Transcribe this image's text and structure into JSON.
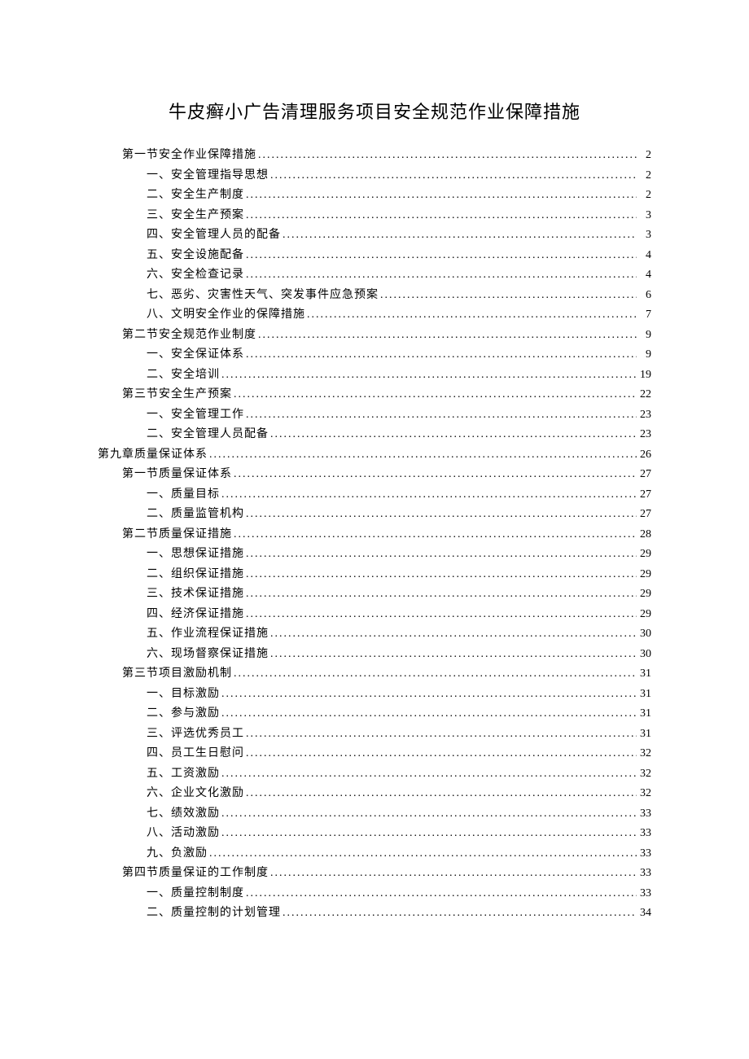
{
  "title": "牛皮癣小广告清理服务项目安全规范作业保障措施",
  "toc": [
    {
      "level": 1,
      "label": "第一节安全作业保障措施",
      "page": "2"
    },
    {
      "level": 2,
      "label": "一、安全管理指导思想",
      "page": "2"
    },
    {
      "level": 2,
      "label": "二、安全生产制度",
      "page": "2"
    },
    {
      "level": 2,
      "label": "三、安全生产预案",
      "page": "3"
    },
    {
      "level": 2,
      "label": "四、安全管理人员的配备",
      "page": "3"
    },
    {
      "level": 2,
      "label": "五、安全设施配备",
      "page": "4"
    },
    {
      "level": 2,
      "label": "六、安全检查记录",
      "page": "4"
    },
    {
      "level": 2,
      "label": "七、恶劣、灾害性天气、突发事件应急预案",
      "page": "6"
    },
    {
      "level": 2,
      "label": "八、文明安全作业的保障措施",
      "page": "7"
    },
    {
      "level": 1,
      "label": "第二节安全规范作业制度",
      "page": "9"
    },
    {
      "level": 2,
      "label": "一、安全保证体系",
      "page": "9"
    },
    {
      "level": 2,
      "label": "二、安全培训",
      "page": "19"
    },
    {
      "level": 1,
      "label": "第三节安全生产预案",
      "page": "22"
    },
    {
      "level": 2,
      "label": "一、安全管理工作",
      "page": "23"
    },
    {
      "level": 2,
      "label": "二、安全管理人员配备",
      "page": "23"
    },
    {
      "level": 0,
      "label": "第九章质量保证体系",
      "page": "26"
    },
    {
      "level": 1,
      "label": "第一节质量保证体系",
      "page": "27"
    },
    {
      "level": 2,
      "label": "一、质量目标",
      "page": "27"
    },
    {
      "level": 2,
      "label": "二、质量监管机构",
      "page": "27"
    },
    {
      "level": 1,
      "label": "第二节质量保证措施",
      "page": "28"
    },
    {
      "level": 2,
      "label": "一、思想保证措施",
      "page": "29"
    },
    {
      "level": 2,
      "label": "二、组织保证措施",
      "page": "29"
    },
    {
      "level": 2,
      "label": "三、技术保证措施",
      "page": "29"
    },
    {
      "level": 2,
      "label": "四、经济保证措施",
      "page": "29"
    },
    {
      "level": 2,
      "label": "五、作业流程保证措施",
      "page": "30"
    },
    {
      "level": 2,
      "label": "六、现场督察保证措施",
      "page": "30"
    },
    {
      "level": 1,
      "label": "第三节项目激励机制",
      "page": "31"
    },
    {
      "level": 2,
      "label": "一、目标激励",
      "page": "31"
    },
    {
      "level": 2,
      "label": "二、参与激励",
      "page": "31"
    },
    {
      "level": 2,
      "label": "三、评选优秀员工",
      "page": "31"
    },
    {
      "level": 2,
      "label": "四、员工生日慰问",
      "page": "32"
    },
    {
      "level": 2,
      "label": "五、工资激励",
      "page": "32"
    },
    {
      "level": 2,
      "label": "六、企业文化激励",
      "page": "32"
    },
    {
      "level": 2,
      "label": "七、绩效激励",
      "page": "33"
    },
    {
      "level": 2,
      "label": "八、活动激励",
      "page": "33"
    },
    {
      "level": 2,
      "label": "九、负激励",
      "page": "33"
    },
    {
      "level": 1,
      "label": "第四节质量保证的工作制度",
      "page": "33"
    },
    {
      "level": 2,
      "label": "一、质量控制制度",
      "page": "33"
    },
    {
      "level": 2,
      "label": "二、质量控制的计划管理",
      "page": "34"
    }
  ]
}
